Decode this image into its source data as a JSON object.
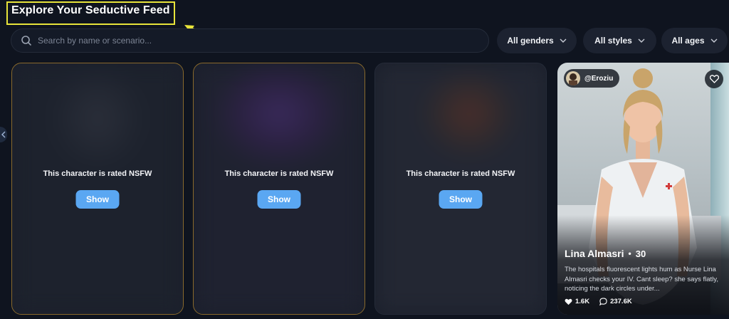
{
  "header": {
    "title": "Explore Your Seductive Feed"
  },
  "search": {
    "placeholder": "Search by name or scenario..."
  },
  "filters": {
    "genders": "All genders",
    "styles": "All styles",
    "ages": "All ages"
  },
  "cards": [
    {
      "nsfw_text": "This character is rated NSFW",
      "show_label": "Show"
    },
    {
      "nsfw_text": "This character is rated NSFW",
      "show_label": "Show"
    },
    {
      "nsfw_text": "This character is rated NSFW",
      "show_label": "Show"
    }
  ],
  "featured": {
    "creator": "@Eroziu",
    "name": "Lina Almasri",
    "separator": "•",
    "age": "30",
    "description": "The hospitals fluorescent lights hum as Nurse Lina Almasri checks your IV. Cant sleep? she says flatly, noticing the dark circles under...",
    "likes": "1.6K",
    "comments": "237.6K"
  },
  "colors": {
    "background": "#0f141f",
    "annotation": "#e8e43a",
    "show_button": "#5aa7f2",
    "gold_border": "#8a6a2c"
  }
}
